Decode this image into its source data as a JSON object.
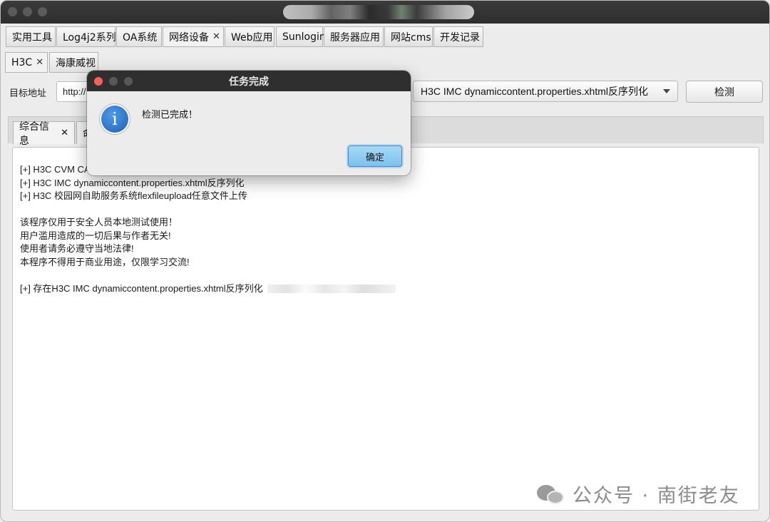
{
  "tabs_main": [
    {
      "label": "实用工具"
    },
    {
      "label": "Log4j2系列"
    },
    {
      "label": "OA系统"
    },
    {
      "label": "网络设备",
      "close": "✕"
    },
    {
      "label": "Web应用"
    },
    {
      "label": "Sunlogin"
    },
    {
      "label": "服务器应用"
    },
    {
      "label": "网站cms"
    },
    {
      "label": "开发记录"
    }
  ],
  "tabs_sub": [
    {
      "label": "H3C",
      "close": "✕"
    },
    {
      "label": "海康威视"
    }
  ],
  "form": {
    "target_label": "目标地址",
    "url_value": "http://",
    "exploit_selected": "H3C IMC dynamiccontent.properties.xhtml反序列化",
    "check_button": "检测"
  },
  "panel_tabs": [
    {
      "label": "综合信息",
      "close": "✕"
    },
    {
      "label": "命"
    }
  ],
  "output": {
    "lines": [
      "[+] H3C CVM CAS",
      "[+] H3C IMC dynamiccontent.properties.xhtml反序列化",
      "[+] H3C 校园网自助服务系统flexfileupload任意文件上传",
      "",
      "该程序仅用于安全人员本地测试使用！",
      "用户滥用造成的一切后果与作者无关!",
      "使用者请务必遵守当地法律!",
      "本程序不得用于商业用途，仅限学习交流!",
      "",
      "[+] 存在H3C IMC dynamiccontent.properties.xhtml反序列化"
    ]
  },
  "dialog": {
    "title": "任务完成",
    "message": "检测已完成！",
    "icon_glyph": "i",
    "ok_button": "确定"
  },
  "watermark": {
    "text": "公众号 · 南街老友"
  }
}
